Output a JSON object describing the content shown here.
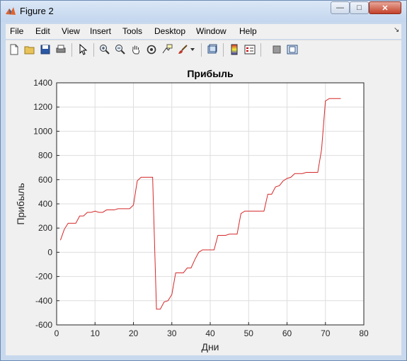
{
  "window": {
    "title": "Figure 2"
  },
  "title_buttons": {
    "minimize": "—",
    "maximize": "□",
    "close": "✕"
  },
  "menu": [
    {
      "label": "File"
    },
    {
      "label": "Edit"
    },
    {
      "label": "View"
    },
    {
      "label": "Insert"
    },
    {
      "label": "Tools"
    },
    {
      "label": "Desktop"
    },
    {
      "label": "Window"
    },
    {
      "label": "Help"
    }
  ],
  "toolbar": [
    "new-figure-icon",
    "open-file-icon",
    "save-icon",
    "print-icon",
    "edit-plot-arrow-icon",
    "zoom-in-icon",
    "zoom-out-icon",
    "pan-hand-icon",
    "rotate-3d-icon",
    "data-cursor-icon",
    "brush-icon",
    "link-plot-icon",
    "insert-colorbar-icon",
    "insert-legend-icon",
    "hide-plot-tools-icon",
    "show-plot-tools-icon"
  ],
  "chart_data": {
    "type": "line",
    "title": "Прибыль",
    "xlabel": "Дни",
    "ylabel": "Прибыль",
    "xlim": [
      0,
      80
    ],
    "ylim": [
      -600,
      1400
    ],
    "xticks": [
      0,
      10,
      20,
      30,
      40,
      50,
      60,
      70,
      80
    ],
    "yticks": [
      -600,
      -400,
      -200,
      0,
      200,
      400,
      600,
      800,
      1000,
      1200,
      1400
    ],
    "grid": true,
    "line_color": "#d62728",
    "series": [
      {
        "x": [
          1,
          2,
          3,
          4,
          5,
          6,
          7,
          8,
          9,
          10,
          11,
          12,
          13,
          14,
          15,
          16,
          17,
          18,
          19,
          20,
          21,
          22,
          23,
          24,
          25,
          26,
          27,
          28,
          29,
          30,
          31,
          32,
          33,
          34,
          35,
          36,
          37,
          38,
          39,
          40,
          41,
          42,
          43,
          44,
          45,
          46,
          47,
          48,
          49,
          50,
          51,
          52,
          53,
          54,
          55,
          56,
          57,
          58,
          59,
          60,
          61,
          62,
          63,
          64,
          65,
          66,
          67,
          68,
          69,
          70,
          71,
          72,
          73,
          74
        ],
        "y": [
          100,
          190,
          240,
          240,
          240,
          300,
          300,
          330,
          330,
          340,
          330,
          330,
          350,
          350,
          350,
          360,
          360,
          360,
          360,
          390,
          590,
          620,
          620,
          620,
          620,
          -470,
          -470,
          -410,
          -400,
          -350,
          -170,
          -170,
          -170,
          -130,
          -130,
          -60,
          0,
          20,
          20,
          20,
          20,
          140,
          140,
          140,
          150,
          150,
          150,
          320,
          340,
          340,
          340,
          340,
          340,
          340,
          480,
          480,
          540,
          550,
          590,
          610,
          620,
          650,
          650,
          650,
          660,
          660,
          660,
          660,
          850,
          1250,
          1270,
          1270,
          1270,
          1270
        ]
      }
    ]
  }
}
